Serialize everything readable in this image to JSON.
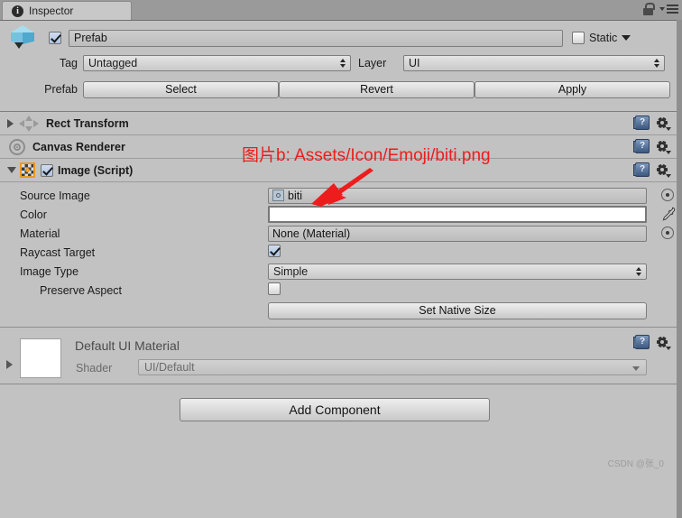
{
  "window": {
    "tab_label": "Inspector",
    "tab_icon": "info-icon",
    "lock_icon": "lock-icon",
    "menu_icon": "hamburger-menu-icon"
  },
  "object_header": {
    "prefab_icon": "prefab-cube-icon",
    "enabled_checkbox": true,
    "name": "Prefab",
    "static_label": "Static",
    "tag_label": "Tag",
    "tag_value": "Untagged",
    "layer_label": "Layer",
    "layer_value": "UI",
    "prefab_label": "Prefab",
    "select_label": "Select",
    "revert_label": "Revert",
    "apply_label": "Apply"
  },
  "components": [
    {
      "title": "Rect Transform",
      "icon": "rect-transform-icon",
      "expanded": false
    },
    {
      "title": "Canvas Renderer",
      "icon": "canvas-renderer-icon",
      "expanded": false
    },
    {
      "title": "Image (Script)",
      "icon": "sprite-icon",
      "expanded": true,
      "enabled": true
    }
  ],
  "image_component": {
    "rows": [
      {
        "label": "Source Image",
        "value": "biti"
      },
      {
        "label": "Color",
        "value": ""
      },
      {
        "label": "Material",
        "value": "None (Material)"
      },
      {
        "label": "Raycast Target",
        "value": ""
      },
      {
        "label": "Image Type",
        "value": "Simple"
      },
      {
        "label": "Preserve Aspect",
        "value": ""
      }
    ],
    "set_native_size_label": "Set Native Size",
    "color_swatch": "#ffffff",
    "raycast_target_checked": true,
    "preserve_aspect_checked": false
  },
  "material_block": {
    "title": "Default UI Material",
    "shader_label": "Shader",
    "shader_value": "UI/Default",
    "swatch_color": "#ffffff"
  },
  "footer": {
    "add_component_label": "Add Component",
    "watermark": "CSDN @张_0"
  },
  "annotation": {
    "text": "图片b: Assets/Icon/Emoji/biti.png",
    "color": "#ef1c1c",
    "arrow": "red-arrow-pointing-to-source-image"
  },
  "icons": {
    "help": "?",
    "gear": "gear-icon"
  }
}
